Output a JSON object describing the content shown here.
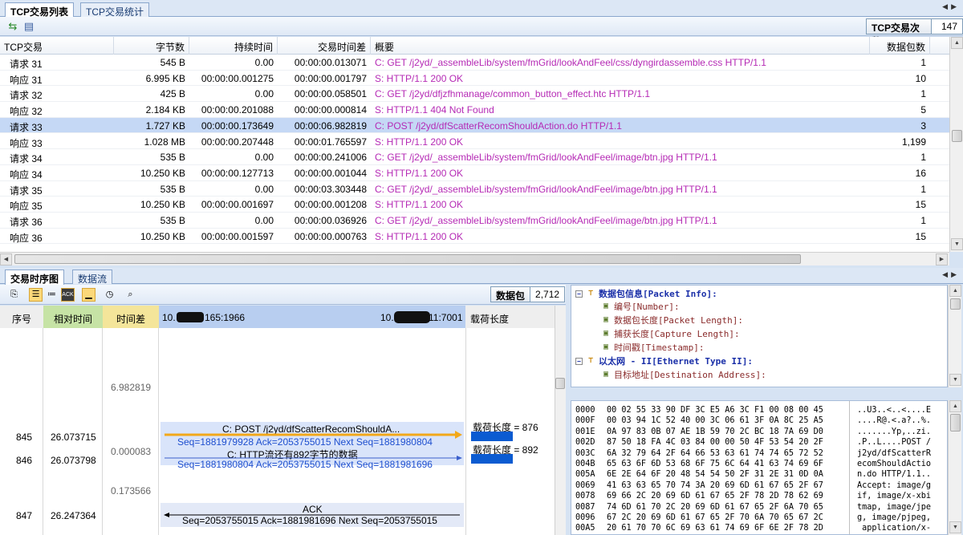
{
  "top_tabs": [
    "TCP交易列表",
    "TCP交易统计"
  ],
  "count_label": "TCP交易次数",
  "count_value": "147",
  "columns": [
    "TCP交易",
    "字节数",
    "持续时间",
    "交易时间差",
    "概要",
    "数据包数"
  ],
  "rows": [
    {
      "txn": "请求 31",
      "bytes": "545  B",
      "duration": "0.00",
      "diff": "00:00:00.013071",
      "summary": "C: GET /j2yd/_assembleLib/system/fmGrid/lookAndFeel/css/dyngirdassemble.css HTTP/1.1",
      "packets": "1",
      "selected": false
    },
    {
      "txn": "响应 31",
      "bytes": "6.995 KB",
      "duration": "00:00:00.001275",
      "diff": "00:00:00.001797",
      "summary": "S: HTTP/1.1 200 OK",
      "packets": "10",
      "selected": false
    },
    {
      "txn": "请求 32",
      "bytes": "425  B",
      "duration": "0.00",
      "diff": "00:00:00.058501",
      "summary": "C: GET /j2yd/dfjzfhmanage/common_button_effect.htc HTTP/1.1",
      "packets": "1",
      "selected": false
    },
    {
      "txn": "响应 32",
      "bytes": "2.184 KB",
      "duration": "00:00:00.201088",
      "diff": "00:00:00.000814",
      "summary": "S: HTTP/1.1 404 Not Found",
      "packets": "5",
      "selected": false
    },
    {
      "txn": "请求 33",
      "bytes": "1.727 KB",
      "duration": "00:00:00.173649",
      "diff": "00:00:06.982819",
      "summary": "C: POST /j2yd/dfScatterRecomShouldAction.do HTTP/1.1",
      "packets": "3",
      "selected": true
    },
    {
      "txn": "响应 33",
      "bytes": "1.028 MB",
      "duration": "00:00:00.207448",
      "diff": "00:00:01.765597",
      "summary": "S: HTTP/1.1 200 OK",
      "packets": "1,199",
      "selected": false
    },
    {
      "txn": "请求 34",
      "bytes": "535  B",
      "duration": "0.00",
      "diff": "00:00:00.241006",
      "summary": "C: GET /j2yd/_assembleLib/system/fmGrid/lookAndFeel/image/btn.jpg HTTP/1.1",
      "packets": "1",
      "selected": false
    },
    {
      "txn": "响应 34",
      "bytes": "10.250 KB",
      "duration": "00:00:00.127713",
      "diff": "00:00:00.001044",
      "summary": "S: HTTP/1.1 200 OK",
      "packets": "16",
      "selected": false
    },
    {
      "txn": "请求 35",
      "bytes": "535  B",
      "duration": "0.00",
      "diff": "00:00:03.303448",
      "summary": "C: GET /j2yd/_assembleLib/system/fmGrid/lookAndFeel/image/btn.jpg HTTP/1.1",
      "packets": "1",
      "selected": false
    },
    {
      "txn": "响应 35",
      "bytes": "10.250 KB",
      "duration": "00:00:00.001697",
      "diff": "00:00:00.001208",
      "summary": "S: HTTP/1.1 200 OK",
      "packets": "15",
      "selected": false
    },
    {
      "txn": "请求 36",
      "bytes": "535  B",
      "duration": "0.00",
      "diff": "00:00:00.036926",
      "summary": "C: GET /j2yd/_assembleLib/system/fmGrid/lookAndFeel/image/btn.jpg HTTP/1.1",
      "packets": "1",
      "selected": false
    },
    {
      "txn": "响应 36",
      "bytes": "10.250 KB",
      "duration": "00:00:00.001597",
      "diff": "00:00:00.000763",
      "summary": "S: HTTP/1.1 200 OK",
      "packets": "15",
      "selected": false
    }
  ],
  "bottom_tabs": [
    "交易时序图",
    "数据流"
  ],
  "packet_label": "数据包",
  "packet_value": "2,712",
  "seq_headers": [
    "序号",
    "相对时间",
    "时间差",
    "10.",
    "165:1966",
    "10.",
    "11:7001",
    "载荷长度"
  ],
  "seq_rows": [
    {
      "no": "845",
      "rel": "26.073715"
    },
    {
      "no": "846",
      "rel": "26.073798"
    },
    {
      "no": "847",
      "rel": "26.247364"
    }
  ],
  "diffs": [
    "6.982819",
    "0.000083",
    "0.173566"
  ],
  "messages": [
    {
      "title": "C: POST /j2yd/dfScatterRecomShouldA...",
      "detail": "Seq=1881979928  Ack=2053755015  Next Seq=1881980804"
    },
    {
      "title": "C: HTTP流还有892字节的数据",
      "detail": "Seq=1881980804  Ack=2053755015  Next Seq=1881981696"
    },
    {
      "title": "ACK",
      "detail": "Seq=2053755015  Ack=1881981696  Next Seq=2053755015"
    }
  ],
  "payloads": [
    "载荷长度 = 876",
    "载荷长度 = 892"
  ],
  "tree": [
    {
      "label": "数据包信息[Packet Info]:",
      "group": true
    },
    {
      "label": "编号[Number]:",
      "group": false
    },
    {
      "label": "数据包长度[Packet Length]:",
      "group": false
    },
    {
      "label": "捕获长度[Capture Length]:",
      "group": false
    },
    {
      "label": "时间戳[Timestamp]:",
      "group": false
    },
    {
      "label": "以太网 - II[Ethernet Type II]:",
      "group": true
    },
    {
      "label": "目标地址[Destination Address]:",
      "group": false
    }
  ],
  "hex_lines": [
    {
      "off": "0000",
      "bytes": "00 02 55 33 90 DF 3C E5 A6 3C F1 00 08 00 45",
      "ascii": "..U3..<..<....E"
    },
    {
      "off": "000F",
      "bytes": "00 03 94 1C 52 40 00 3C 06 61 3F 0A 8C 25 A5",
      "ascii": "....R@.<.a?..%."
    },
    {
      "off": "001E",
      "bytes": "0A 97 83 0B 07 AE 1B 59 70 2C BC 18 7A 69 D0",
      "ascii": ".......Yp,..zi."
    },
    {
      "off": "002D",
      "bytes": "87 50 18 FA 4C 03 84 00 00 50 4F 53 54 20 2F",
      "ascii": ".P..L....POST /"
    },
    {
      "off": "003C",
      "bytes": "6A 32 79 64 2F 64 66 53 63 61 74 74 65 72 52",
      "ascii": "j2yd/dfScatterR"
    },
    {
      "off": "004B",
      "bytes": "65 63 6F 6D 53 68 6F 75 6C 64 41 63 74 69 6F",
      "ascii": "ecomShouldActio"
    },
    {
      "off": "005A",
      "bytes": "6E 2E 64 6F 20 48 54 54 50 2F 31 2E 31 0D 0A",
      "ascii": "n.do HTTP/1.1.."
    },
    {
      "off": "0069",
      "bytes": "41 63 63 65 70 74 3A 20 69 6D 61 67 65 2F 67",
      "ascii": "Accept: image/g"
    },
    {
      "off": "0078",
      "bytes": "69 66 2C 20 69 6D 61 67 65 2F 78 2D 78 62 69",
      "ascii": "if, image/x-xbi"
    },
    {
      "off": "0087",
      "bytes": "74 6D 61 70 2C 20 69 6D 61 67 65 2F 6A 70 65",
      "ascii": "tmap, image/jpe"
    },
    {
      "off": "0096",
      "bytes": "67 2C 20 69 6D 61 67 65 2F 70 6A 70 65 67 2C",
      "ascii": "g, image/pjpeg,"
    },
    {
      "off": "00A5",
      "bytes": "20 61 70 70 6C 69 63 61 74 69 6F 6E 2F 78 2D",
      "ascii": " application/x-"
    }
  ]
}
